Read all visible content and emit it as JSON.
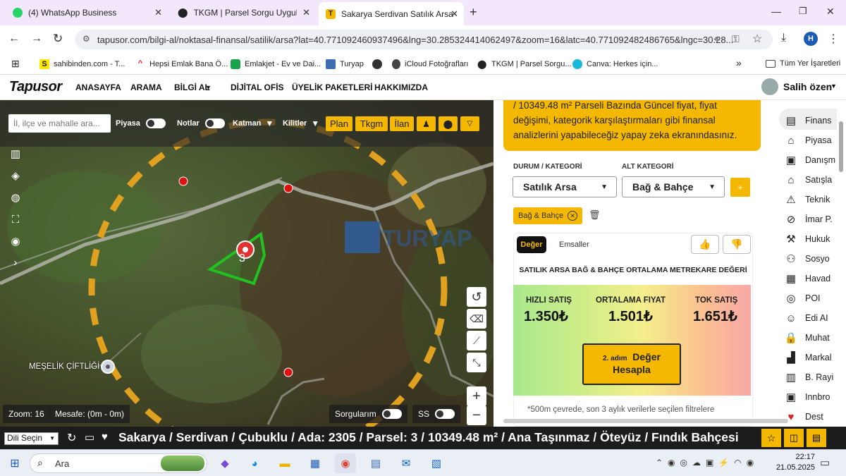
{
  "browser": {
    "tabs": [
      {
        "title": "(4) WhatsApp Business"
      },
      {
        "title": "TKGM | Parsel Sorgu Uygulama"
      },
      {
        "title": "Sakarya Serdivan Satılık Arsa"
      }
    ],
    "url": "tapusor.com/bilgi-al/noktasal-finansal/satilik/arsa?lat=40.771092460937496&lng=30.285324414062497&zoom=16&latc=40.771092482486765&lngc=30.28...",
    "profile_initial": "H",
    "bookmarks": [
      {
        "label": "sahibinden.com - T..."
      },
      {
        "label": "Hepsi Emlak Bana Ö..."
      },
      {
        "label": "Emlakjet - Ev ve Dai..."
      },
      {
        "label": "Turyap"
      },
      {
        "label": "iCloud Fotoğrafları"
      },
      {
        "label": "TKGM | Parsel Sorgu..."
      },
      {
        "label": "Canva: Herkes için..."
      }
    ],
    "all_bookmarks": "Tüm Yer İşaretleri"
  },
  "site": {
    "logo": "Tapusor",
    "nav": [
      "ANASAYFA",
      "ARAMA",
      "BİLGİ AL",
      "DİJİTAL OFİS",
      "ÜYELİK PAKETLERİ",
      "HAKKIMIZDA"
    ],
    "user": "Salih özen"
  },
  "map": {
    "search_placeholder": "İl, ilçe ve mahalle ara...",
    "toggles": {
      "piyasa": "Piyasa",
      "notlar": "Notlar",
      "katman": "Katman",
      "kilitler": "Kilitler"
    },
    "buttons": [
      "Plan",
      "Tkgm",
      "İlan"
    ],
    "parcel_number": "3",
    "place_label": "MEŞELİK ÇİFTLİĞİ",
    "watermark": "TURYAP",
    "zoom": "Zoom: 16",
    "distance": "Mesafe: (0m - 0m)",
    "sorgularim": "Sorgularım",
    "ss": "SS"
  },
  "panel": {
    "intro_line1": "/ 10349.48 m² Parseli Bazında Güncel fiyat, fiyat",
    "intro_line2": "değişimi, kategorik karşılaştırmaları gibi finansal",
    "intro_line3": "analizlerini yapabileceğiz yapay zeka ekranındasınız.",
    "durum_label": "DURUM / KATEGORİ",
    "durum_value": "Satılık Arsa",
    "alt_label": "ALT KATEGORİ",
    "alt_value": "Bağ & Bahçe",
    "plus": "+",
    "chip": "Bağ & Bahçe",
    "tabs": [
      "Değer",
      "Emsaller"
    ],
    "heading": "SATILIK ARSA BAĞ & BAHÇE ORTALAMA METREKARE DEĞERİ",
    "prices": [
      {
        "label": "HIZLI SATIŞ",
        "value": "1.350₺"
      },
      {
        "label": "ORTALAMA FIYAT",
        "value": "1.501₺"
      },
      {
        "label": "TOK SATIŞ",
        "value": "1.651₺"
      }
    ],
    "step_small": "2. adım",
    "step_big1": "Değer",
    "step_big2": "Hesapla",
    "footnote": "*500m çevrede, son 3 aylık verilerle seçilen filtrelere",
    "side_items": [
      "Finans",
      "Piyasa",
      "Danışm",
      "Satışla",
      "Teknik",
      "İmar P.",
      "Hukuk",
      "Sosyo",
      "Havad",
      "POI",
      "Edi AI",
      "Muhat",
      "Markal",
      "B. Rayi",
      "Innbro",
      "Dest"
    ]
  },
  "bottom": {
    "language": "Dili Seçin",
    "location": "Sakarya / Serdivan / Çubuklu / Ada: 2305 / Parsel: 3 / 10349.48 m² / Ana Taşınmaz / Öteyüz / Fındık Bahçesi"
  },
  "taskbar": {
    "search": "Ara",
    "time": "22:17",
    "date": "21.05.2025"
  },
  "colors": {
    "accent": "#f5b800",
    "dark": "#1c1c1c",
    "parcel": "#22c122",
    "circle": "#e0a020"
  }
}
